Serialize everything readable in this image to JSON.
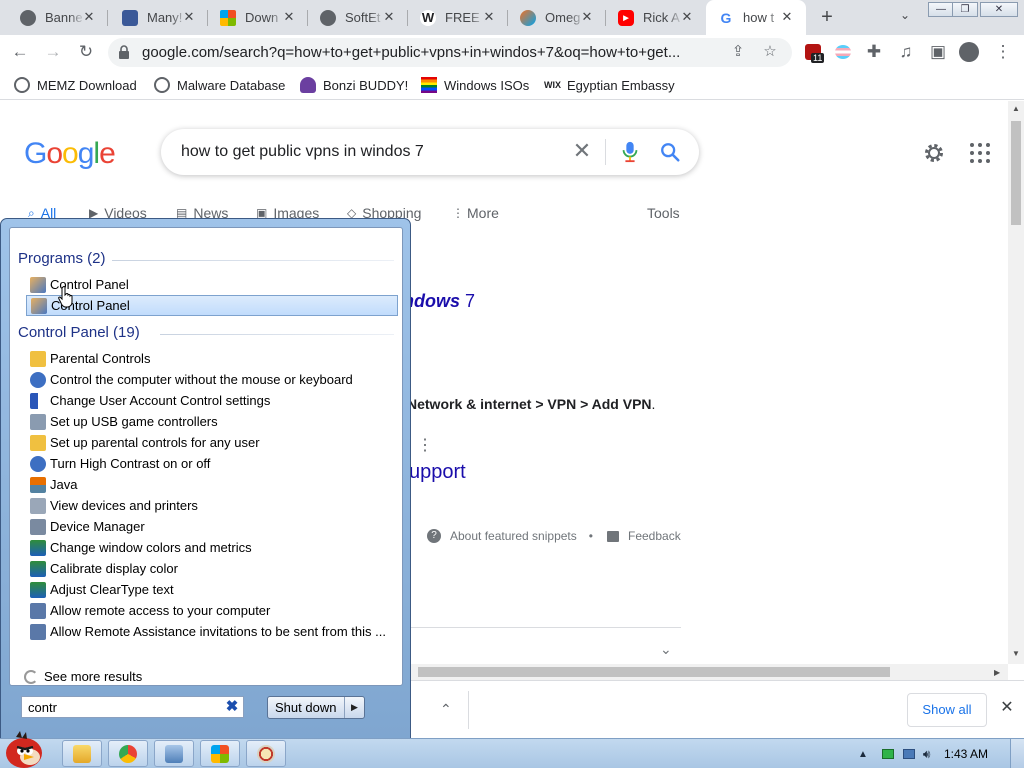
{
  "browser": {
    "tabs": [
      {
        "label": "Banne",
        "icon": "chrome-favicon",
        "color": "#5f6368"
      },
      {
        "label": "Many!",
        "icon": "puzzle-favicon",
        "color": "#3b5998"
      },
      {
        "label": "Down",
        "icon": "windows-logo-favicon",
        "color": "#e94b35"
      },
      {
        "label": "SoftEt",
        "icon": "chrome-favicon",
        "color": "#5f6368"
      },
      {
        "label": "FREE I",
        "icon": "w-favicon",
        "color": "#202124"
      },
      {
        "label": "Omeg",
        "icon": "omegle-favicon",
        "color": "#f37021"
      },
      {
        "label": "Rick A",
        "icon": "youtube-favicon",
        "color": "#ff0000"
      },
      {
        "label": "how t",
        "icon": "google-favicon",
        "color": "#4285f4"
      }
    ],
    "url": "google.com/search?q=how+to+get+public+vpns+in+windos+7&oq=how+to+get...",
    "bookmarks": [
      {
        "label": "MEMZ Download",
        "icon": "globe-icon",
        "color": "#5f6368"
      },
      {
        "label": "Malware Database",
        "icon": "globe-icon",
        "color": "#5f6368"
      },
      {
        "label": "Bonzi BUDDY!",
        "icon": "bonzi-icon",
        "color": "#6b3fa0"
      },
      {
        "label": "Windows ISOs",
        "icon": "rainbow-flag-icon",
        "color": "#e40303"
      },
      {
        "label": "Egyptian Embassy",
        "icon": "wix-icon",
        "color": "#000000"
      }
    ],
    "extension_badge": "11"
  },
  "google": {
    "logo": "Google",
    "query": "how to get public vpns in windos 7",
    "tabs": [
      {
        "label": "All",
        "icon": "search-icon"
      },
      {
        "label": "Videos",
        "icon": "video-icon"
      },
      {
        "label": "News",
        "icon": "news-icon"
      },
      {
        "label": "Images",
        "icon": "image-icon"
      },
      {
        "label": "Shopping",
        "icon": "tag-icon"
      },
      {
        "label": "More",
        "icon": "kebab-icon"
      }
    ],
    "tools_label": "Tools",
    "snippet_title_visible": "ndows",
    "snippet_title_tail": " 7",
    "snippet_step": "Network & internet > VPN > Add VPN",
    "snippet_step_tail": ".",
    "snippet_link": "upport",
    "about_featured": "About featured snippets",
    "feedback": "Feedback",
    "bullet": "•"
  },
  "download_bar": {
    "show_all": "Show all"
  },
  "start_menu": {
    "programs_header": "Programs (2)",
    "programs": [
      {
        "label": "Control Panel",
        "selected": false
      },
      {
        "label": "Control Panel",
        "selected": true
      }
    ],
    "control_panel_header": "Control Panel (19)",
    "control_panel_items": [
      "Parental Controls",
      "Control the computer without the mouse or keyboard",
      "Change User Account Control settings",
      "Set up USB game controllers",
      "Set up parental controls for any user",
      "Turn High Contrast on or off",
      "Java",
      "View devices and printers",
      "Device Manager",
      "Change window colors and metrics",
      "Calibrate display color",
      "Adjust ClearType text",
      "Allow remote access to your computer",
      "Allow Remote Assistance invitations to be sent from this ..."
    ],
    "see_more": "See more results",
    "search_value": "contr",
    "shutdown_label": "Shut down"
  },
  "taskbar": {
    "clock": "1:43 AM",
    "pinned": [
      "explorer-icon",
      "chrome-icon",
      "network-icon",
      "windows-logo-icon",
      "paint-icon"
    ]
  },
  "colors": {
    "google_blue": "#4285f4",
    "google_red": "#ea4335",
    "google_yellow": "#fbbc05",
    "google_green": "#34a853",
    "link_blue": "#1a0dab",
    "accent_blue": "#1a73e8"
  }
}
